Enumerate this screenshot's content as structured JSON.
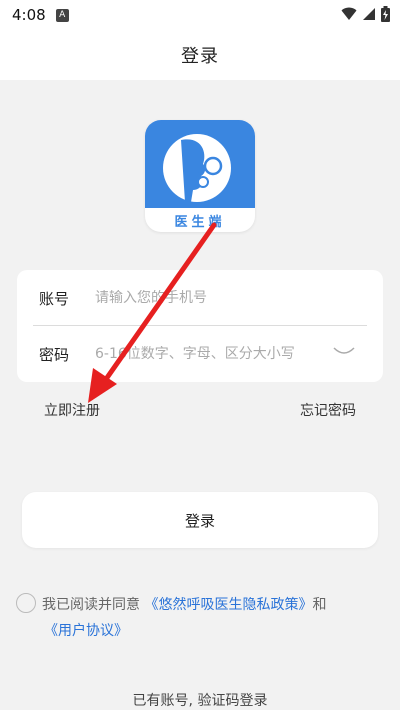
{
  "status_bar": {
    "time": "4:08",
    "notification_badge": "A"
  },
  "header": {
    "title": "登录"
  },
  "logo": {
    "caption": "医生端",
    "brand_color": "#3a86e0"
  },
  "form": {
    "account_label": "账号",
    "account_placeholder": "请输入您的手机号",
    "password_label": "密码",
    "password_placeholder": "6-16位数字、字母、区分大小写"
  },
  "links": {
    "register": "立即注册",
    "forgot_password": "忘记密码"
  },
  "login_button": "登录",
  "agreement": {
    "prefix": "我已阅读并同意",
    "privacy_policy": "《悠然呼吸医生隐私政策》",
    "connector": "和",
    "user_agreement": "《用户协议》"
  },
  "code_login_link": "已有账号, 验证码登录",
  "colors": {
    "link": "#2a73d8",
    "annotation_arrow": "#e62020"
  }
}
